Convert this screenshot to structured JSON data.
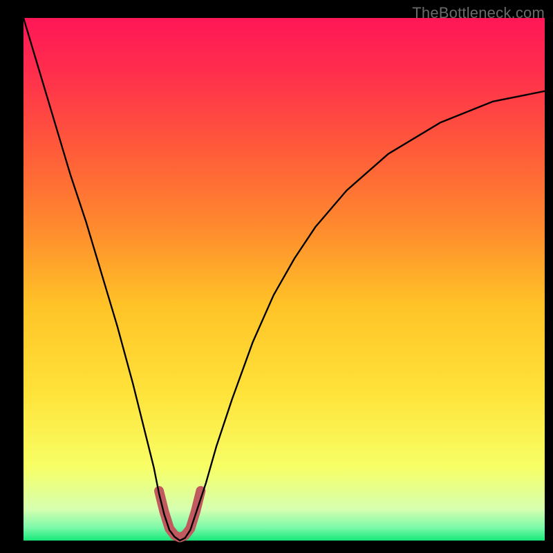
{
  "watermark": "TheBottleneck.com",
  "colors": {
    "background": "#000000",
    "gradient_stops": [
      {
        "offset": 0.0,
        "color": "#ff1757"
      },
      {
        "offset": 0.1,
        "color": "#ff2d4d"
      },
      {
        "offset": 0.25,
        "color": "#ff5a3a"
      },
      {
        "offset": 0.4,
        "color": "#ff8a2e"
      },
      {
        "offset": 0.55,
        "color": "#ffc327"
      },
      {
        "offset": 0.72,
        "color": "#ffe33a"
      },
      {
        "offset": 0.86,
        "color": "#f7ff66"
      },
      {
        "offset": 0.94,
        "color": "#d6ffb0"
      },
      {
        "offset": 0.975,
        "color": "#7cf9a9"
      },
      {
        "offset": 1.0,
        "color": "#17e87a"
      }
    ],
    "curve": "#000000",
    "trough_marker": "#c05a5f"
  },
  "chart_data": {
    "type": "line",
    "title": "",
    "xlabel": "",
    "ylabel": "",
    "xlim": [
      0,
      100
    ],
    "ylim": [
      0,
      100
    ],
    "grid": false,
    "legend": false,
    "annotations": [],
    "series": [
      {
        "name": "curve",
        "color": "#000000",
        "x": [
          0,
          3,
          6,
          9,
          12,
          15,
          18,
          21,
          23,
          25,
          26,
          27,
          28,
          29,
          30,
          31,
          32,
          33,
          35,
          37,
          40,
          44,
          48,
          52,
          56,
          62,
          70,
          80,
          90,
          100
        ],
        "values": [
          100,
          90,
          80,
          70,
          61,
          51,
          41,
          30,
          22,
          14,
          9,
          5,
          2,
          0.7,
          0,
          0.5,
          2,
          5,
          11,
          18,
          27,
          38,
          47,
          54,
          60,
          67,
          74,
          80,
          84,
          86
        ]
      }
    ],
    "trough_marker": {
      "type": "path",
      "color": "#c05a5f",
      "thickness_px": 14,
      "points_xy": [
        [
          26,
          9.5
        ],
        [
          27,
          5.5
        ],
        [
          28,
          2.3
        ],
        [
          29,
          1.0
        ],
        [
          30,
          0.6
        ],
        [
          31,
          1.0
        ],
        [
          32,
          2.3
        ],
        [
          33,
          5.5
        ],
        [
          34,
          9.5
        ]
      ]
    }
  }
}
